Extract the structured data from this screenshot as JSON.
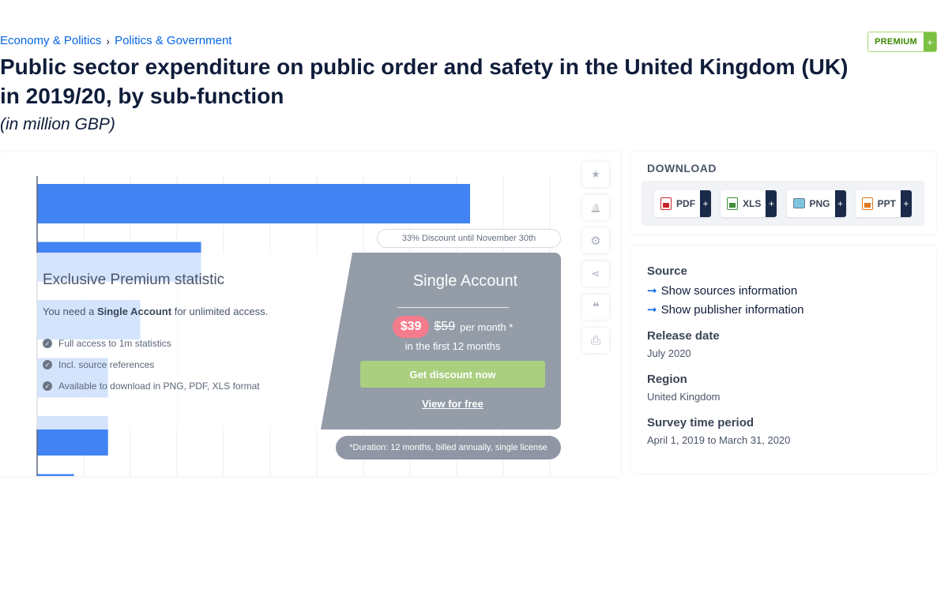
{
  "breadcrumb": {
    "item1": "Economy & Politics",
    "separator": "›",
    "item2": "Politics & Government"
  },
  "premium_badge": {
    "label": "PREMIUM",
    "plus": "+"
  },
  "title": "Public sector expenditure on public order and safety in the United Kingdom (UK) in 2019/20, by sub-function",
  "subtitle": "(in million GBP)",
  "chart_data": {
    "type": "bar",
    "orientation": "horizontal",
    "note": "values obscured by paywall overlay; relative bar lengths shown",
    "values": [
      9400,
      3560,
      2240,
      1540,
      1540,
      800
    ],
    "bar_color": "#4384f4",
    "grid": true
  },
  "tools": [
    {
      "name": "star-icon",
      "glyph": "★"
    },
    {
      "name": "bell-icon",
      "glyph": "🔔"
    },
    {
      "name": "gear-icon",
      "glyph": "⚙"
    },
    {
      "name": "share-icon",
      "glyph": "⋖"
    },
    {
      "name": "quote-icon",
      "glyph": "❝"
    },
    {
      "name": "print-icon",
      "glyph": "⎙"
    }
  ],
  "paywall": {
    "discount": "33% Discount until November 30th",
    "heading": "Exclusive Premium statistic",
    "need_prefix": "You need a",
    "need_bold": "Single Account",
    "need_suffix": "for unlimited access.",
    "features": [
      "Full access to 1m statistics",
      "Incl. source references",
      "Available to download in PNG, PDF, XLS format"
    ],
    "account_title": "Single Account",
    "price_new": "$39",
    "price_old": "$59",
    "price_per": "per month *",
    "price_first": "in the first 12 months",
    "cta": "Get discount now",
    "free_link": "View for free",
    "duration": "*Duration: 12 months, billed annually, single license"
  },
  "download": {
    "title": "DOWNLOAD",
    "buttons": [
      {
        "label": "PDF",
        "icon": "pdf-file-icon",
        "plus": "+"
      },
      {
        "label": "XLS",
        "icon": "xls-file-icon",
        "plus": "+"
      },
      {
        "label": "PNG",
        "icon": "png-file-icon",
        "plus": "+"
      },
      {
        "label": "PPT",
        "icon": "ppt-file-icon",
        "plus": "+"
      }
    ]
  },
  "info": {
    "source_label": "Source",
    "sources_link": "Show sources information",
    "publisher_link": "Show publisher information",
    "release_label": "Release date",
    "release_value": "July 2020",
    "region_label": "Region",
    "region_value": "United Kingdom",
    "survey_label": "Survey time period",
    "survey_value": "April 1, 2019 to March 31, 2020",
    "arrow": "➞"
  }
}
